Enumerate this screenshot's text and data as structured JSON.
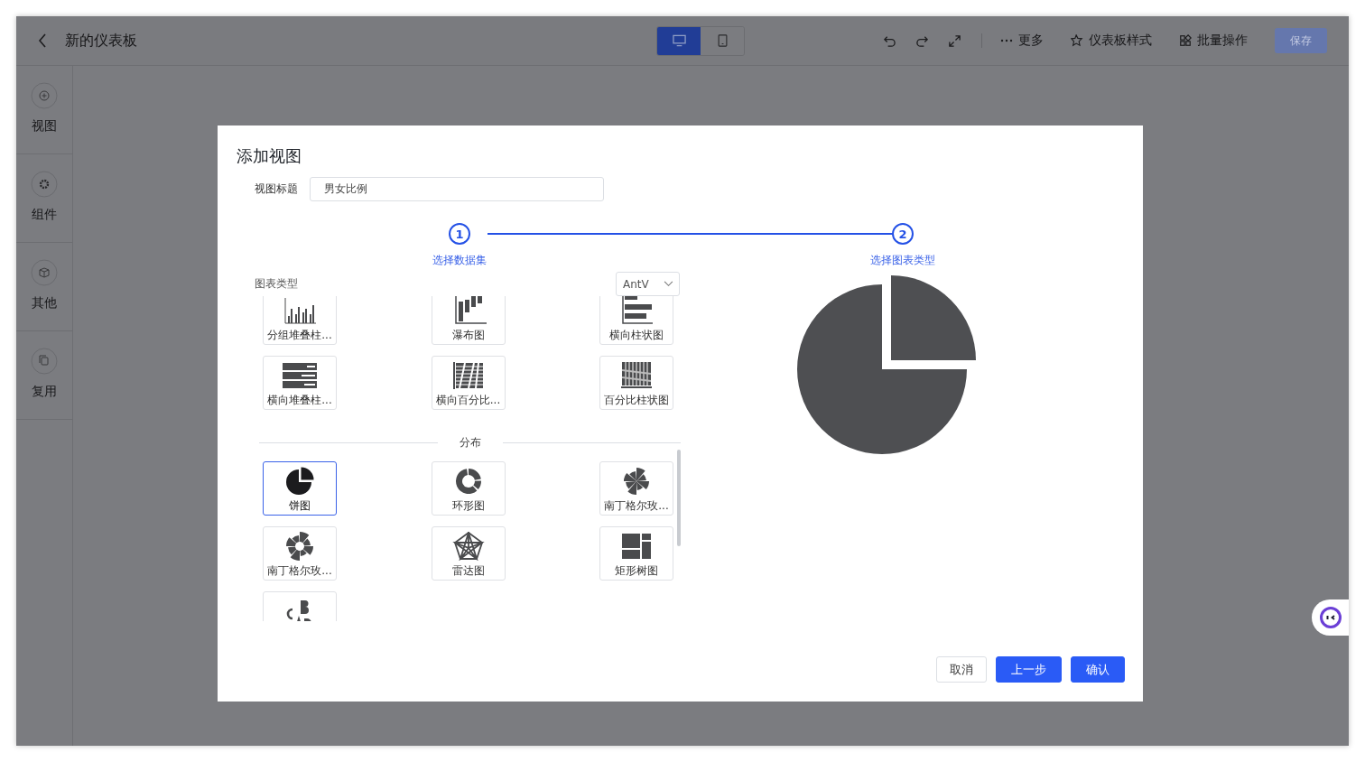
{
  "header": {
    "title": "新的仪表板",
    "device_toggle": [
      {
        "kind": "desktop",
        "selected": true
      },
      {
        "kind": "mobile",
        "selected": false
      }
    ],
    "actions": [
      {
        "kind": "more",
        "label": "更多"
      },
      {
        "kind": "style",
        "label": "仪表板样式"
      },
      {
        "kind": "batch",
        "label": "批量操作"
      }
    ],
    "save": {
      "label": "保存",
      "disabled": true
    }
  },
  "sidebar": {
    "items": [
      {
        "kind": "add",
        "label": "视图"
      },
      {
        "kind": "gear",
        "label": "组件"
      },
      {
        "kind": "box",
        "label": "其他"
      },
      {
        "kind": "copy",
        "label": "复用"
      }
    ]
  },
  "dialog": {
    "title": "添加视图",
    "title_field": {
      "label": "视图标题",
      "value": "男女比例"
    },
    "steps": [
      {
        "number": "1",
        "label": "选择数据集"
      },
      {
        "number": "2",
        "label": "选择图表类型"
      }
    ],
    "chart_types": {
      "label": "图表类型",
      "library": "AntV",
      "groups": [
        {
          "tiles": [
            {
              "kind": "grouped-stacked-bar",
              "label": "分组堆叠柱...",
              "selected": false
            },
            {
              "kind": "waterfall",
              "label": "瀑布图",
              "selected": false
            },
            {
              "kind": "horizontal-bar",
              "label": "横向柱状图",
              "selected": false
            },
            {
              "kind": "horizontal-stacked-bar",
              "label": "横向堆叠柱...",
              "selected": false
            },
            {
              "kind": "horizontal-percent-bar",
              "label": "横向百分比...",
              "selected": false
            },
            {
              "kind": "percent-column",
              "label": "百分比柱状图",
              "selected": false
            }
          ]
        },
        {
          "title": "分布",
          "tiles": [
            {
              "kind": "pie",
              "label": "饼图",
              "selected": true
            },
            {
              "kind": "donut",
              "label": "环形图",
              "selected": false
            },
            {
              "kind": "rose",
              "label": "南丁格尔玫...",
              "selected": false
            },
            {
              "kind": "rose-ring",
              "label": "南丁格尔玫...",
              "selected": false
            },
            {
              "kind": "radar",
              "label": "雷达图",
              "selected": false
            },
            {
              "kind": "treemap",
              "label": "矩形树图",
              "selected": false
            },
            {
              "kind": "word-cloud",
              "selected": false
            }
          ]
        }
      ]
    },
    "buttons": [
      {
        "kind": "default",
        "label": "取消"
      },
      {
        "kind": "primary",
        "label": "上一步"
      },
      {
        "kind": "primary",
        "label": "确认"
      }
    ]
  }
}
